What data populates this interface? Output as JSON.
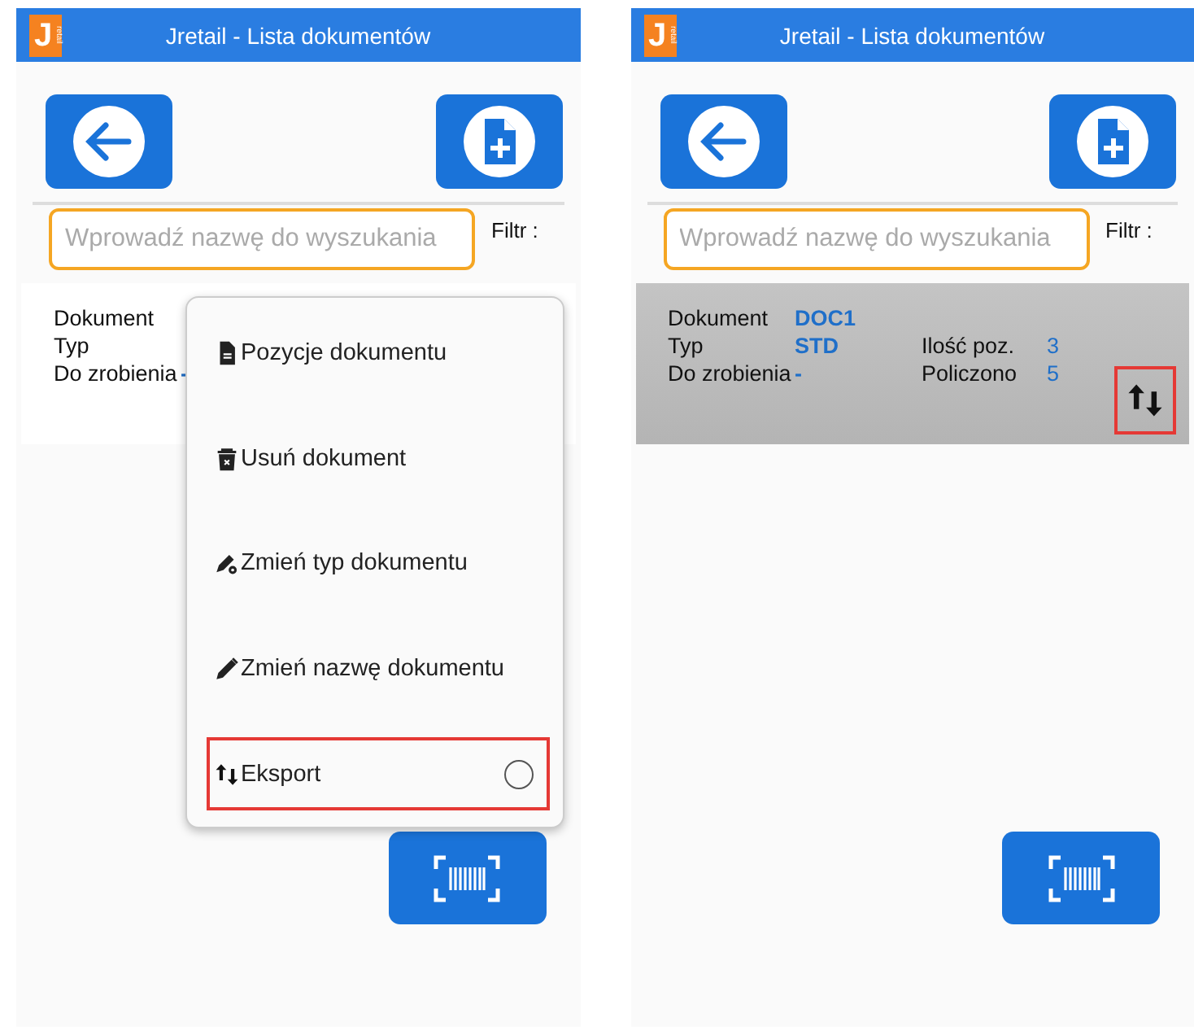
{
  "screens": [
    {
      "header": {
        "logo_letter": "J",
        "logo_tag": "retail",
        "title": "Jretail - Lista dokumentów"
      },
      "search": {
        "placeholder": "Wprowadź nazwę do wyszukania"
      },
      "filter_label": "Filtr :",
      "document": {
        "selected": false,
        "details": [
          {
            "label": "Dokument"
          },
          {
            "label": "Typ"
          },
          {
            "label": "Do zrobienia",
            "value": "-"
          }
        ]
      },
      "menu": [
        {
          "kind": "positions",
          "label": "Pozycje dokumentu",
          "highlighted": false
        },
        {
          "kind": "delete",
          "label": "Usuń dokument",
          "highlighted": false
        },
        {
          "kind": "type",
          "label": "Zmień typ dokumentu",
          "highlighted": false
        },
        {
          "kind": "rename",
          "label": "Zmień nazwę dokumentu",
          "highlighted": false
        },
        {
          "kind": "export",
          "label": "Eksport",
          "highlighted": true,
          "selected": false
        }
      ]
    },
    {
      "header": {
        "logo_letter": "J",
        "logo_tag": "retail",
        "title": "Jretail - Lista dokumentów"
      },
      "search": {
        "placeholder": "Wprowadź nazwę do wyszukania"
      },
      "filter_label": "Filtr :",
      "document": {
        "selected": true,
        "details": [
          {
            "label": "Dokument",
            "value": "DOC1"
          },
          {
            "label": "Typ",
            "value": "STD"
          },
          {
            "label": "Do zrobienia",
            "value": "-"
          }
        ],
        "counts": [
          {
            "label": "Ilość poz.",
            "value": "3"
          },
          {
            "label": "Policzono",
            "value": "5"
          }
        ],
        "export": {
          "highlighted": true
        }
      }
    }
  ]
}
